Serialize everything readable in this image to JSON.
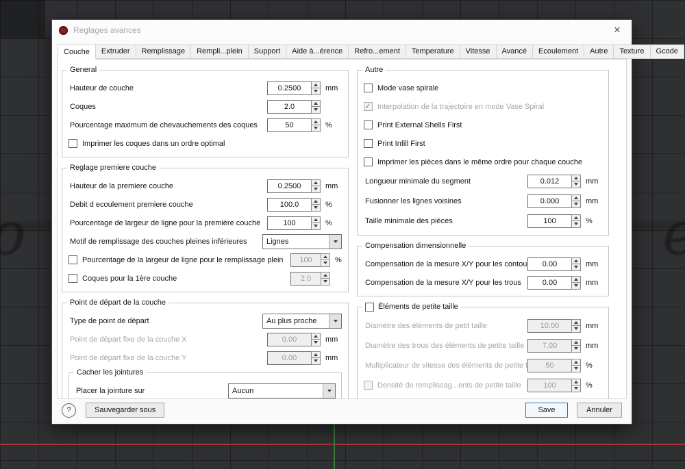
{
  "window": {
    "title": "Reglages avances",
    "close": "✕"
  },
  "tabs": [
    "Couche",
    "Extruder",
    "Remplissage",
    "Rempli...plein",
    "Support",
    "Aide à...érence",
    "Refro...ement",
    "Temperature",
    "Vitesse",
    "Avancé",
    "Ecoulement",
    "Autre",
    "Texture",
    "Gcode"
  ],
  "general": {
    "title": "General",
    "rows": [
      {
        "label": "Hauteur de couche",
        "value": "0.2500",
        "unit": "mm"
      },
      {
        "label": "Coques",
        "value": "2.0",
        "unit": ""
      },
      {
        "label": "Pourcentage maximum de chevauchements des coques",
        "value": "50",
        "unit": "%"
      }
    ],
    "check": "Imprimer les coques dans un ordre optimal"
  },
  "fl": {
    "title": "Reglage premiere couche",
    "rows": [
      {
        "label": "Hauteur de la premiere couche",
        "value": "0.2500",
        "unit": "mm"
      },
      {
        "label": "Debit d ecoulement premiere couche",
        "value": "100.0",
        "unit": "%"
      },
      {
        "label": "Pourcentage de largeur de ligne pour la première couche",
        "value": "100",
        "unit": "%"
      }
    ],
    "pattern": {
      "label": "Motif de remplissage des couches pleines inférieures",
      "value": "Lignes"
    },
    "check1": {
      "label": "Pourcentage de la largeur de ligne pour le remplissage plein",
      "value": "100",
      "unit": "%"
    },
    "check2": {
      "label": "Coques pour la 1ère couche",
      "value": "2.0",
      "unit": ""
    }
  },
  "sp": {
    "title": "Point de départ de la couche",
    "type": {
      "label": "Type de point de départ",
      "value": "Au plus proche"
    },
    "rows": [
      {
        "label": "Point de départ fixe de la couche X",
        "value": "0.00",
        "unit": "mm"
      },
      {
        "label": "Point de départ fixe de la couche Y",
        "value": "0.00",
        "unit": "mm"
      }
    ],
    "seam": {
      "title": "Cacher les jointures",
      "label": "Placer la jointure sur",
      "value": "Aucun"
    }
  },
  "autre": {
    "title": "Autre",
    "checks": [
      "Mode vase spirale",
      "Interpolation de la trajectoire en mode Vase Spiral",
      "Print External Shells First",
      "Print Infill First",
      "Imprimer les pièces dans le même ordre pour chaque couche"
    ],
    "rows": [
      {
        "label": "Longueur minimale du segment",
        "value": "0.012",
        "unit": "mm"
      },
      {
        "label": "Fusionner les lignes voisines",
        "value": "0.000",
        "unit": "mm"
      },
      {
        "label": "Taille minimale des pièces",
        "value": "100",
        "unit": "%"
      }
    ]
  },
  "comp": {
    "title": "Compensation dimensionnelle",
    "rows": [
      {
        "label": "Compensation de la mesure X/Y pour les contours",
        "value": "0.00",
        "unit": "mm"
      },
      {
        "label": "Compensation de la mesure X/Y pour les trous",
        "value": "0.00",
        "unit": "mm"
      }
    ]
  },
  "small": {
    "title": "Éléments de petite taille",
    "rows": [
      {
        "label": "Diamètre des éléments de petit taille",
        "value": "10.00",
        "unit": "mm"
      },
      {
        "label": "Diamètre des trous des éléments de petite taille",
        "value": "7.00",
        "unit": "mm"
      },
      {
        "label": "Multiplicateur de vitesse des éléments de petite taille",
        "value": "50",
        "unit": "%"
      }
    ],
    "check": {
      "label": "Densité de remplissag...ents de petite taille",
      "value": "100",
      "unit": "%"
    }
  },
  "footer": {
    "help": "?",
    "save_as": "Sauvegarder sous",
    "save": "Save",
    "cancel": "Annuler"
  }
}
